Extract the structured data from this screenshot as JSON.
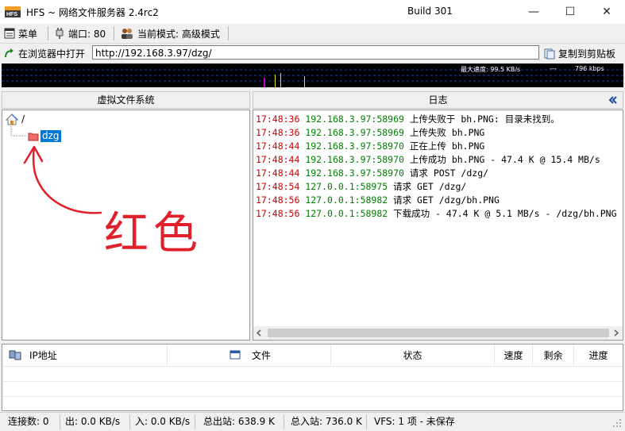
{
  "window": {
    "title": "HFS ~ 网络文件服务器 2.4rc2",
    "build": "Build 301",
    "minimize_glyph": "—",
    "maximize_glyph": "☐",
    "close_glyph": "✕"
  },
  "toolbar": {
    "menu_label": "菜单",
    "port_label": "端口: 80",
    "mode_label": "当前模式: 高级模式"
  },
  "urlbar": {
    "open_label": "在浏览器中打开",
    "url": "http://192.168.3.97/dzg/",
    "copy_label": "复制到剪贴板"
  },
  "graph": {
    "max_speed": "最大速度: 99.5 KB/s",
    "dashes": "---",
    "kbps": "796 kbps"
  },
  "vfs": {
    "header": "虚拟文件系统",
    "root": "/",
    "folder": "dzg",
    "annotation": "红色"
  },
  "log": {
    "header": "日志",
    "lines": [
      {
        "time": "17:48:36",
        "addr": "192.168.3.97:58969",
        "msg": "上传失败于 bh.PNG: 目录未找到。"
      },
      {
        "time": "17:48:36",
        "addr": "192.168.3.97:58969",
        "msg": "上传失败 bh.PNG"
      },
      {
        "time": "17:48:44",
        "addr": "192.168.3.97:58970",
        "msg": "正在上传 bh.PNG"
      },
      {
        "time": "17:48:44",
        "addr": "192.168.3.97:58970",
        "msg": "上传成功 bh.PNG - 47.4 K @ 15.4 MB/s"
      },
      {
        "time": "17:48:44",
        "addr": "192.168.3.97:58970",
        "msg": "请求 POST /dzg/"
      },
      {
        "time": "17:48:54",
        "addr": "127.0.0.1:58975",
        "msg": "请求 GET /dzg/"
      },
      {
        "time": "17:48:56",
        "addr": "127.0.0.1:58982",
        "msg": "请求 GET /dzg/bh.PNG"
      },
      {
        "time": "17:48:56",
        "addr": "127.0.0.1:58982",
        "msg": "下载成功 - 47.4 K @ 5.1 MB/s - /dzg/bh.PNG"
      }
    ]
  },
  "connections": {
    "columns": [
      "IP地址",
      "文件",
      "状态",
      "速度",
      "剩余",
      "进度"
    ]
  },
  "statusbar": {
    "connections": "连接数: 0",
    "out_speed": "出: 0.0 KB/s",
    "in_speed": "入: 0.0 KB/s",
    "total_out": "总出站: 638.9 K",
    "total_in": "总入站: 736.0 K",
    "vfs": "VFS: 1 项 - 未保存"
  },
  "colors": {
    "log_time": "#d00000",
    "log_addr": "#008000",
    "annotation": "#e0202a",
    "selection": "#0078d7"
  }
}
